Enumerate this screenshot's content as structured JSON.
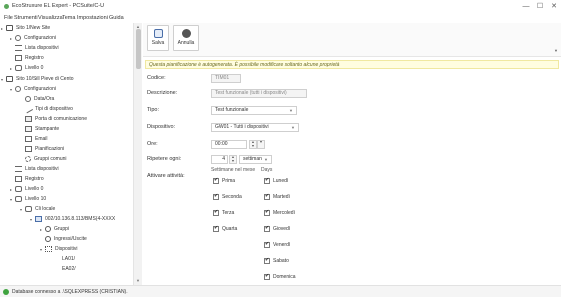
{
  "window": {
    "title": "EcoStruxure EL Expert - PCSuite/C-U",
    "minimize": "—",
    "maximize": "☐",
    "close": "✕"
  },
  "menu": [
    "File",
    "Strumenti",
    "Visualizza",
    "Tema",
    "Impostazioni",
    "Guida"
  ],
  "tree": {
    "items": [
      {
        "label": "Sito 1/New Site",
        "toggle": "▸",
        "icon": "site-icon"
      },
      {
        "label": "Configurazioni",
        "toggle": "▸",
        "icon": "gear-icon"
      },
      {
        "label": "Lista dispositivi",
        "toggle": "",
        "icon": "list-icon"
      },
      {
        "label": "Registro",
        "toggle": "",
        "icon": "document-icon"
      },
      {
        "label": "Livello 0",
        "toggle": "▸",
        "icon": "level-icon"
      },
      {
        "label": "Sito 10/Sill Pieve di Cento",
        "toggle": "▾",
        "icon": "site-icon"
      },
      {
        "label": "Configurazioni",
        "toggle": "▾",
        "icon": "gear-icon"
      },
      {
        "label": "Data/Ora",
        "toggle": "",
        "icon": "clock-icon"
      },
      {
        "label": "Tipi di dispositivo",
        "toggle": "",
        "icon": "tool-icon"
      },
      {
        "label": "Porta di comunicazione",
        "toggle": "",
        "icon": "port-icon"
      },
      {
        "label": "Stampante",
        "toggle": "",
        "icon": "printer-icon"
      },
      {
        "label": "Email",
        "toggle": "",
        "icon": "mail-icon"
      },
      {
        "label": "Pianificazioni",
        "toggle": "",
        "icon": "calendar-icon"
      },
      {
        "label": "Gruppi comuni",
        "toggle": "",
        "icon": "group-icon"
      },
      {
        "label": "Lista dispositivi",
        "toggle": "",
        "icon": "list-icon"
      },
      {
        "label": "Registro",
        "toggle": "",
        "icon": "document-icon"
      },
      {
        "label": "Livello 0",
        "toggle": "▸",
        "icon": "level-icon"
      },
      {
        "label": "Livello 10",
        "toggle": "▾",
        "icon": "level-icon"
      },
      {
        "label": "Cli locale",
        "toggle": "▾",
        "icon": "network-icon"
      },
      {
        "label": "002/10.136.8.113/BMS(4-XXXX",
        "toggle": "▾",
        "icon": "controller-icon"
      },
      {
        "label": "Gruppi",
        "toggle": "▸",
        "icon": "circle-icon"
      },
      {
        "label": "Ingressi/Uscite",
        "toggle": "",
        "icon": "io-icon"
      },
      {
        "label": "Dispositivi",
        "toggle": "▾",
        "icon": "devices-icon"
      },
      {
        "label": "LA01/",
        "toggle": "",
        "icon": ""
      },
      {
        "label": "EA02/",
        "toggle": "",
        "icon": ""
      }
    ]
  },
  "toolbar": {
    "save_label": "Salva",
    "cancel_label": "Annulla"
  },
  "notice": "Questa pianificazione è autogenerata. È possibile modificare soltanto alcune proprietà",
  "form": {
    "code_label": "Codice:",
    "code_value": "TIM01",
    "desc_label": "Descrizione:",
    "desc_value": "Test funzionale (tutti i dispositivi)",
    "type_label": "Tipo:",
    "type_value": "Test funzionale",
    "device_label": "Dispositivo:",
    "device_value": "GW01 - Tutti i dispositivi",
    "time_label": "Ore:",
    "time_value": "00:00",
    "repeat_label": "Ripetere ogni:",
    "repeat_value": "4",
    "repeat_unit": "settiman",
    "activate_label": "Attivare attività:",
    "weeks_header": "Settimane nel mese",
    "days_header": "Days",
    "weeks": [
      {
        "label": "Prima",
        "checked": true
      },
      {
        "label": "Seconda",
        "checked": true
      },
      {
        "label": "Terza",
        "checked": true
      },
      {
        "label": "Quarta",
        "checked": true
      }
    ],
    "days": [
      {
        "label": "Lunedì",
        "checked": true
      },
      {
        "label": "Martedì",
        "checked": true
      },
      {
        "label": "Mercoledì",
        "checked": true
      },
      {
        "label": "Giovedì",
        "checked": true
      },
      {
        "label": "Venerdì",
        "checked": true
      },
      {
        "label": "Sabato",
        "checked": true
      },
      {
        "label": "Domenica",
        "checked": true
      }
    ]
  },
  "status": "Database connesso a .\\SQLEXPRESS (CRISTIAN)."
}
